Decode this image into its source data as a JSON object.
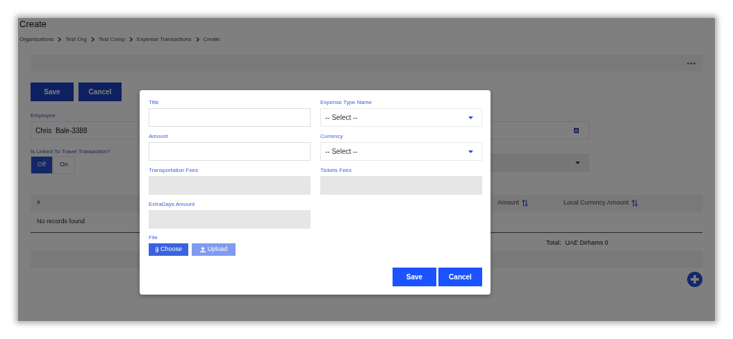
{
  "page": {
    "title": "Create",
    "breadcrumbs": [
      "Organizations",
      "Test Org",
      "Test Comp",
      "Expense Transactions",
      "Create"
    ]
  },
  "actions": [
    "Save",
    "Cancel"
  ],
  "employee": {
    "label": "Employee",
    "value": "Chris  Bale-3388"
  },
  "linked": {
    "label": "Is Linked To Travel Transaction?",
    "options": [
      {
        "label": "Off",
        "selected": true
      },
      {
        "label": "On",
        "selected": false
      }
    ]
  },
  "table": {
    "columns": [
      {
        "label": "#",
        "sortable": false
      },
      {
        "label": "Amount",
        "sortable": true
      },
      {
        "label": "Local Currency Amount",
        "sortable": true
      }
    ],
    "empty_text": "No records found",
    "total_label": "Total:",
    "total_value": "UAE Dirhams 0"
  },
  "modal": {
    "fields": [
      {
        "label": "Title",
        "kind": "text",
        "disabled": false
      },
      {
        "label": "Expense Type Name",
        "kind": "select",
        "disabled": false,
        "value": "-- Select --"
      },
      {
        "label": "Amount",
        "kind": "text",
        "disabled": false
      },
      {
        "label": "Currency",
        "kind": "select",
        "disabled": false,
        "value": "-- Select --"
      },
      {
        "label": "Transportation Fees",
        "kind": "text",
        "disabled": true
      },
      {
        "label": "Tickets Fees",
        "kind": "text",
        "disabled": true
      },
      {
        "label": "ExtraDays Amount",
        "kind": "text",
        "disabled": true
      }
    ],
    "file": {
      "label": "File",
      "buttons": [
        {
          "label": "Choose",
          "kind": "choose",
          "disabled": false
        },
        {
          "label": "Upload",
          "kind": "upload",
          "disabled": true
        }
      ]
    },
    "buttons": [
      "Save",
      "Cancel"
    ]
  }
}
